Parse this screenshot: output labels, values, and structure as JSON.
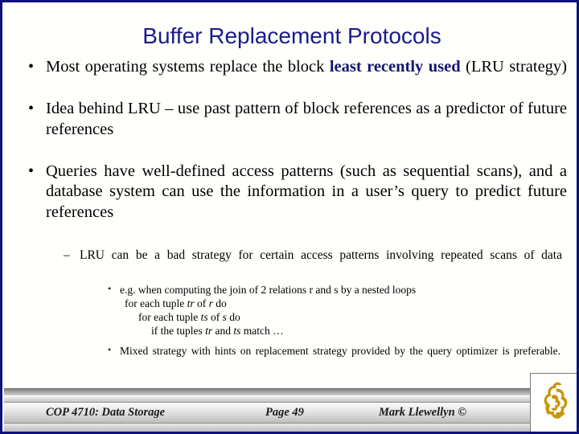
{
  "slide": {
    "title": "Buffer Replacement Protocols",
    "title_color": "#1a1a8c",
    "border_color": "#10107e",
    "background_color": "#fffffc"
  },
  "bullets": [
    {
      "level": 1,
      "marker": "•",
      "text_before": "Most operating systems replace the block ",
      "highlight": "least recently used",
      "highlight_color": "#14146e",
      "text_after": " (LRU strategy)"
    },
    {
      "level": 1,
      "marker": "•",
      "text": "Idea behind LRU – use past pattern of block references as a predictor of future references"
    },
    {
      "level": 1,
      "marker": "•",
      "text": "Queries have well-defined access patterns (such as sequential scans), and a database system can use the information in a user’s query to predict future references"
    }
  ],
  "sub_bullet": {
    "level": 2,
    "marker": "–",
    "text": "LRU can be a bad strategy for certain access patterns involving repeated scans of data"
  },
  "sub_sub_bullets": [
    {
      "level": 3,
      "marker": "•",
      "text": "e.g. when computing the join of 2 relations r and s by a nested loops"
    },
    {
      "level": 3,
      "marker": "•",
      "text": "Mixed strategy with hints on replacement strategy provided by the query optimizer is preferable."
    }
  ],
  "code_lines": [
    {
      "indent": 1,
      "before": "for each tuple ",
      "italic1": "tr",
      "middle": " of ",
      "italic2": "r",
      "after": " do"
    },
    {
      "indent": 2,
      "before": "for each tuple ",
      "italic1": "ts",
      "middle": " of ",
      "italic2": "s",
      "after": " do"
    },
    {
      "indent": 3,
      "before": "if the tuples ",
      "italic1": "tr",
      "middle": " and ",
      "italic2": "ts",
      "after": " match …"
    }
  ],
  "footer": {
    "course": "COP 4710: Data Storage",
    "page": "Page 49",
    "author": "Mark Llewellyn ©",
    "logo_color": "#c8960a",
    "logo_name": "ucf-pegasus-logo"
  }
}
